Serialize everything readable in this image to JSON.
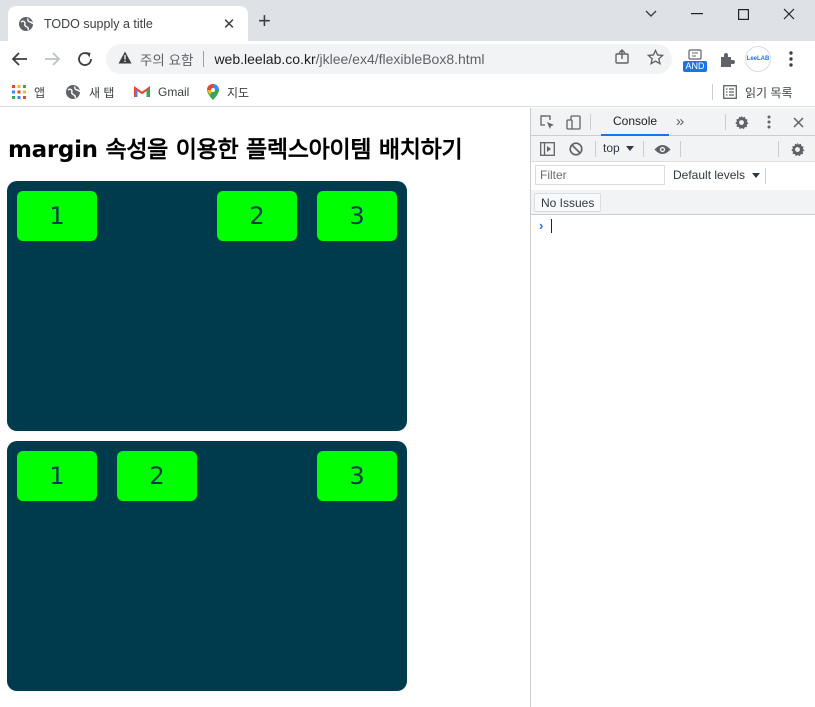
{
  "browser": {
    "tab_title": "TODO supply a title",
    "new_tab_glyph": "+",
    "close_glyph": "✕",
    "security_label": "주의 요함",
    "url_host": "web.leelab.co.kr",
    "url_path": "/jklee/ex4/flexibleBox8.html",
    "extension_badge": "AND",
    "profile_label": "LeeLAB"
  },
  "bookmarks": {
    "apps": "앱",
    "new_tab": "새 탭",
    "gmail": "Gmail",
    "maps": "지도",
    "reading_list": "읽기 목록"
  },
  "page": {
    "heading": "margin 속성을 이용한 플렉스아이템 배치하기",
    "box1": {
      "items": [
        "1",
        "2",
        "3"
      ]
    },
    "box2": {
      "items": [
        "1",
        "2",
        "3"
      ]
    }
  },
  "devtools": {
    "console_tab": "Console",
    "more_tabs": "»",
    "context": "top",
    "filter_placeholder": "Filter",
    "levels": "Default levels",
    "issues": "No Issues",
    "prompt": "›"
  },
  "colors": {
    "flex_container": "#003a4d",
    "flex_item": "#00ff00"
  }
}
